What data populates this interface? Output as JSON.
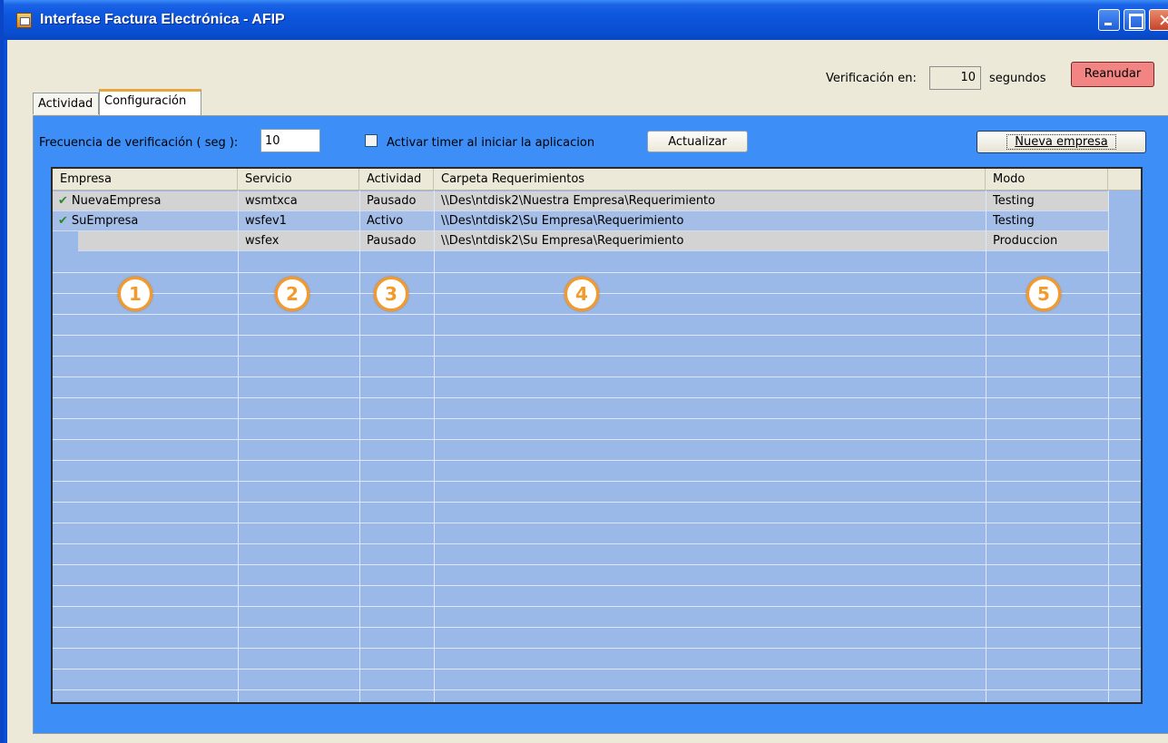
{
  "window": {
    "title": "Interfase Factura Electrónica - AFIP"
  },
  "verification": {
    "label": "Verificación en:",
    "value": "10",
    "unit": "segundos",
    "resume_label": "Reanudar",
    "resume_color": "#f28583"
  },
  "tabs": [
    {
      "label": "Actividad",
      "selected": false
    },
    {
      "label": "Configuración",
      "selected": true
    }
  ],
  "config": {
    "freq_label": "Frecuencia de verificación ( seg ):",
    "freq_value": "10",
    "timer_label": "Activar timer al iniciar la aplicacion",
    "timer_checked": false,
    "update_label": "Actualizar",
    "new_company_label": "Nueva empresa"
  },
  "grid": {
    "headers": [
      "Empresa",
      "Servicio",
      "Actividad",
      "Carpeta Requerimientos",
      "Modo"
    ],
    "rows": [
      {
        "status_icon": "check-icon",
        "empresa": "NuevaEmpresa",
        "servicio": "wsmtxca",
        "actividad": "Pausado",
        "carpeta": "\\\\Des\\ntdisk2\\Nuestra Empresa\\Requerimiento",
        "modo": "Testing"
      },
      {
        "status_icon": "check-icon",
        "empresa": "SuEmpresa",
        "servicio": "wsfev1",
        "actividad": "Activo",
        "carpeta": "\\\\Des\\ntdisk2\\Su Empresa\\Requerimiento",
        "modo": "Testing"
      },
      {
        "status_icon": "none",
        "empresa": "",
        "servicio": "wsfex",
        "actividad": "Pausado",
        "carpeta": "\\\\Des\\ntdisk2\\Su Empresa\\Requerimiento",
        "modo": "Produccion"
      }
    ]
  },
  "callouts": [
    "1",
    "2",
    "3",
    "4",
    "5"
  ],
  "colors": {
    "panel_bg": "#3d8ff7",
    "grid_bg": "#9ab9e8",
    "selected_row": "#d3d3d3",
    "callout": "#f39a2a",
    "titlebar": "#0c56dc"
  }
}
